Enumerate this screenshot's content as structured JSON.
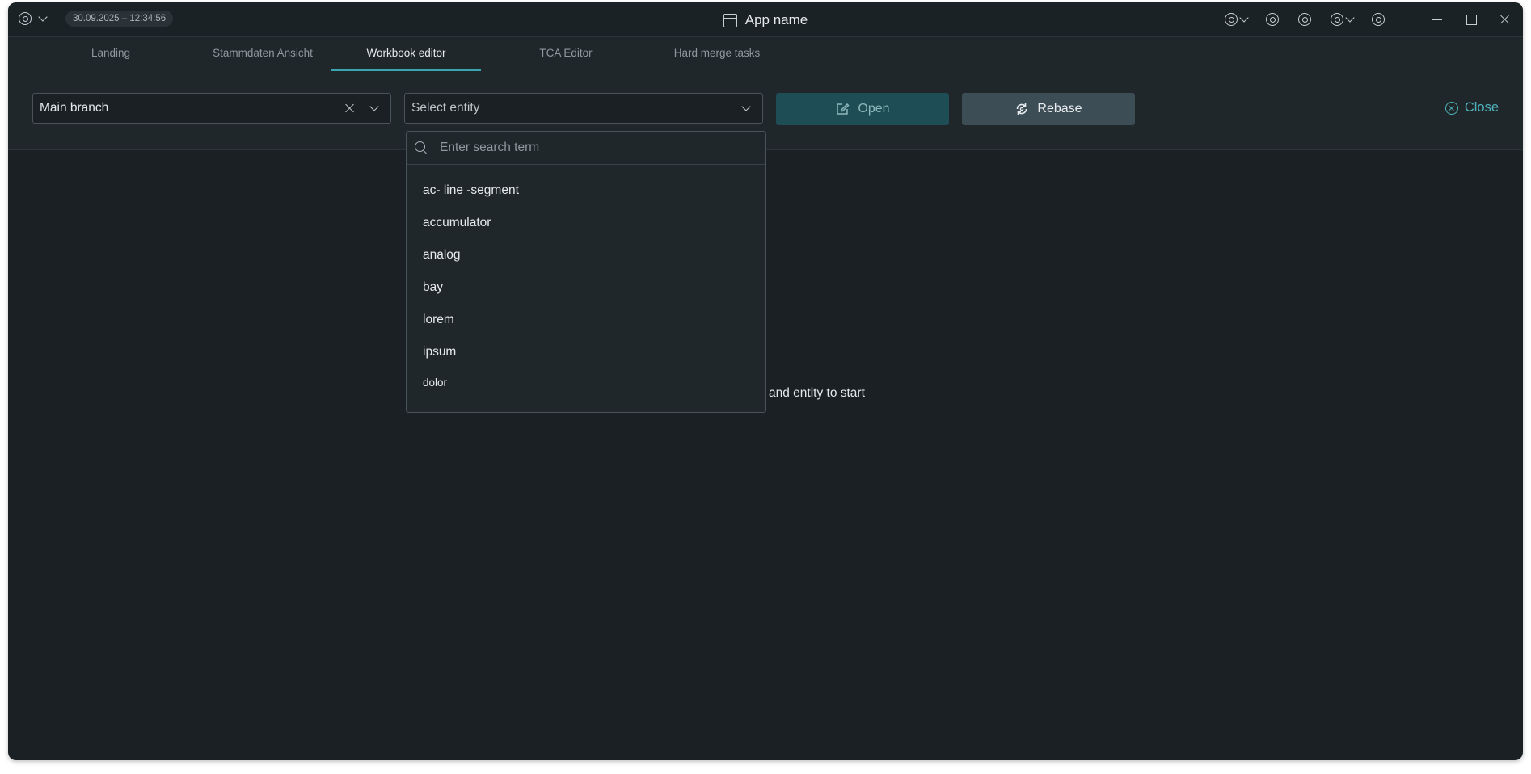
{
  "titlebar": {
    "timestamp": "30.09.2025 – 12:34:56",
    "app_name": "App name"
  },
  "tabs": [
    {
      "label": "Landing"
    },
    {
      "label": "Stammdaten Ansicht"
    },
    {
      "label": "Workbook editor",
      "active": true
    },
    {
      "label": "TCA Editor"
    },
    {
      "label": "Hard merge tasks"
    }
  ],
  "toolbar": {
    "branch_select": "Main branch",
    "entity_select_placeholder": "Select entity",
    "open_label": "Open",
    "rebase_label": "Rebase",
    "close_label": "Close"
  },
  "dropdown": {
    "search_placeholder": "Enter search term",
    "options": [
      "ac- line -segment",
      "accumulator",
      "analog",
      "bay",
      "lorem",
      "ipsum",
      "dolor"
    ]
  },
  "main": {
    "hint_text": "and entity to start"
  },
  "colors": {
    "accent": "#3aa3ad",
    "background": "#1a2024",
    "panel": "#1f272b"
  }
}
